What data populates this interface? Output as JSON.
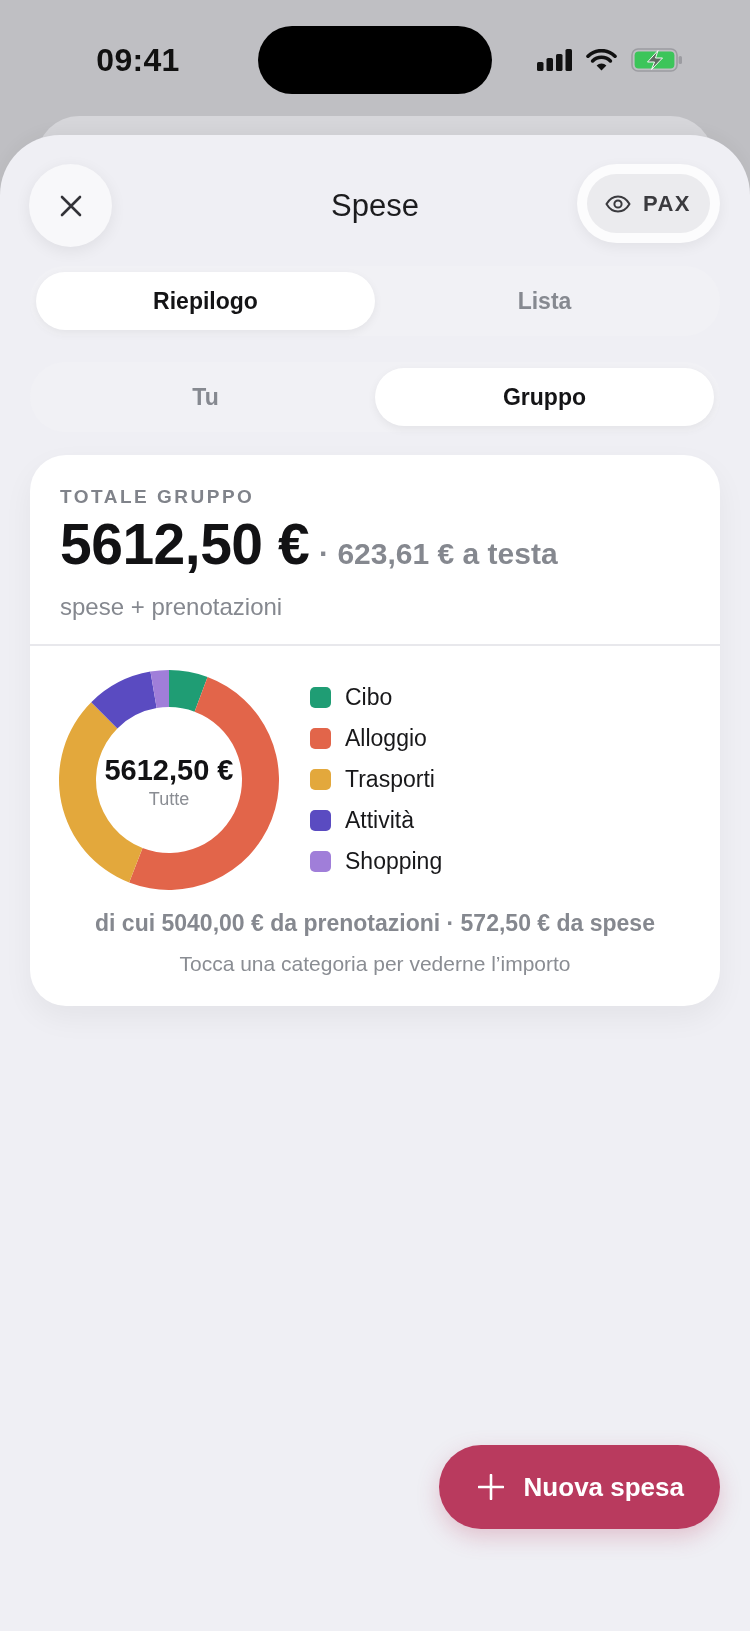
{
  "status_bar": {
    "time": "09:41"
  },
  "header": {
    "title": "Spese",
    "pax_button": {
      "label": "PAX"
    }
  },
  "view_tabs": [
    {
      "label": "Riepilogo",
      "selected": true
    },
    {
      "label": "Lista",
      "selected": false
    }
  ],
  "scope_tabs": [
    {
      "label": "Tu",
      "selected": false
    },
    {
      "label": "Gruppo",
      "selected": true
    }
  ],
  "summary_card": {
    "heading": "TOTALE GRUPPO",
    "total": "5612,50 €",
    "per_person": "· 623,61 € a testa",
    "subtitle": "spese + prenotazioni",
    "donut": {
      "center_value": "5612,50 €",
      "center_label": "Tutte"
    },
    "legend": [
      {
        "label": "Cibo",
        "color": "#1f9d74"
      },
      {
        "label": "Alloggio",
        "color": "#e2654a"
      },
      {
        "label": "Trasporti",
        "color": "#e3a83c"
      },
      {
        "label": "Attività",
        "color": "#5a4bc1"
      },
      {
        "label": "Shopping",
        "color": "#a07ed9"
      }
    ],
    "breakdown": "di cui 5040,00 € da prenotazioni · 572,50 € da spese",
    "hint": "Tocca una categoria per vederne l’importo"
  },
  "fab": {
    "label": "Nuova spesa"
  }
}
